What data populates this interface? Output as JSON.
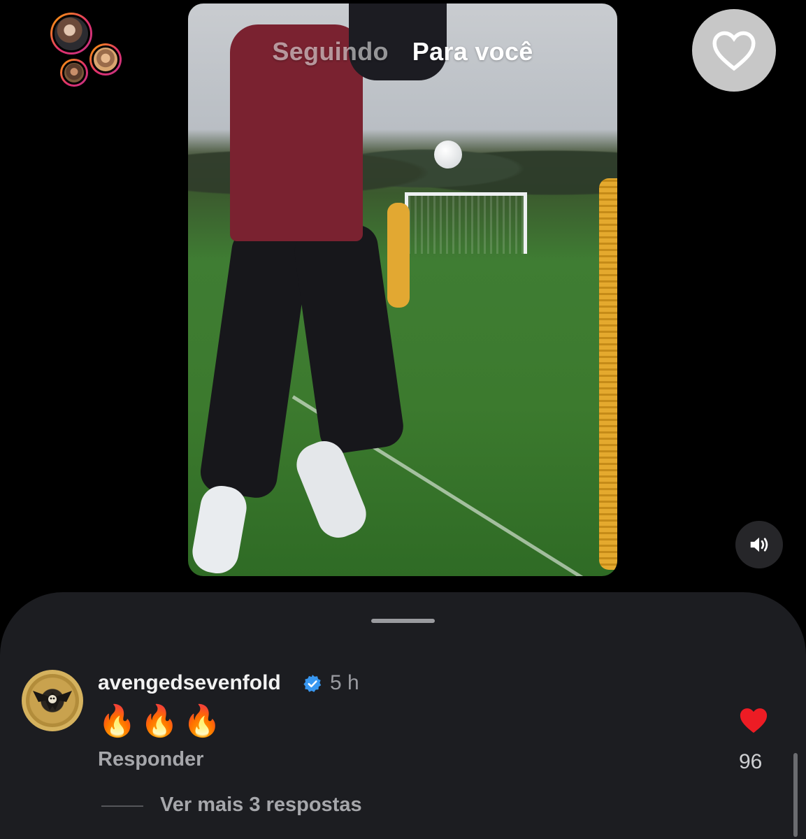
{
  "feed_tabs": [
    {
      "label": "Seguindo",
      "active": false
    },
    {
      "label": "Para você",
      "active": true
    }
  ],
  "icons": {
    "like": "heart-outline-icon",
    "sound": "speaker-icon",
    "verified": "verified-badge-icon",
    "comment_like": "heart-filled-icon"
  },
  "comment": {
    "username": "avengedsevenfold",
    "time": "5 h",
    "text": "🔥🔥🔥",
    "reply_label": "Responder",
    "like_count": "96",
    "more_replies": "Ver mais 3 respostas"
  },
  "colors": {
    "sheet_bg": "#1c1d21",
    "heart_red": "#ed1c24",
    "verified_blue": "#3897f0"
  }
}
